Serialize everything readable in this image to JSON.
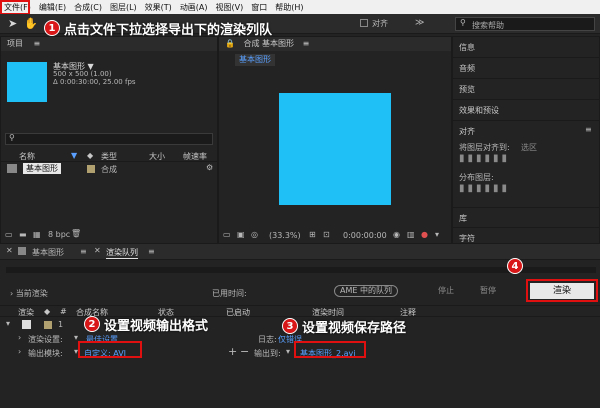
{
  "menu": [
    "文件(F)",
    "编辑(E)",
    "合成(C)",
    "图层(L)",
    "效果(T)",
    "动画(A)",
    "视图(V)",
    "窗口",
    "帮助(H)"
  ],
  "toolbar": {
    "align_label": "对齐"
  },
  "search": {
    "placeholder": "搜索帮助"
  },
  "project": {
    "title": "项目",
    "item_name": "基本图形 ▼",
    "item_meta1": "500 x 500 (1.00)",
    "item_meta2": "Δ 0:00:30:00, 25.00 fps",
    "columns": [
      "名称",
      "类型",
      "大小",
      "帧速率"
    ],
    "row": {
      "name": "基本图形",
      "type": "合成"
    },
    "bpc": "8 bpc"
  },
  "comp": {
    "title": "合成 基本图形",
    "tab": "基本图形",
    "zoom": "(33.3%)",
    "timecode": "0:00:00:00"
  },
  "right_panel": {
    "items": [
      "信息",
      "音频",
      "预览",
      "效果和预设",
      "对齐"
    ],
    "align_to_label": "将图层对齐到:",
    "align_to_value": "选区",
    "distribute_label": "分布图层:",
    "library": "库",
    "chars": "字符"
  },
  "timeline": {
    "tab1": "基本图形",
    "tab2": "渲染队列"
  },
  "render_queue": {
    "current_render": "当前渲染",
    "elapsed": "已用时间:",
    "ame_button": "AME 中的队列",
    "stop": "停止",
    "pause": "暂停",
    "render": "渲染",
    "columns": [
      "渲染",
      "#",
      "合成名称",
      "状态",
      "已启动",
      "渲染时间",
      "注释"
    ],
    "row_num": "1",
    "render_settings_label": "渲染设置:",
    "render_settings_value": "最佳设置",
    "log_label": "日志:",
    "log_value": "仅错误",
    "output_module_label": "输出模块:",
    "output_module_value": "自定义: AVI",
    "output_to_label": "输出到:",
    "output_to_value": "基本图形_2.avi"
  },
  "annotations": {
    "n1": "1",
    "t1": "点击文件下拉选择导出下的渲染列队",
    "n2": "2",
    "t2": "设置视频输出格式",
    "n3": "3",
    "t3": "设置视频保存路径",
    "n4": "4"
  },
  "colors": {
    "accent": "#1ec0f5",
    "annotation": "#e01010"
  }
}
